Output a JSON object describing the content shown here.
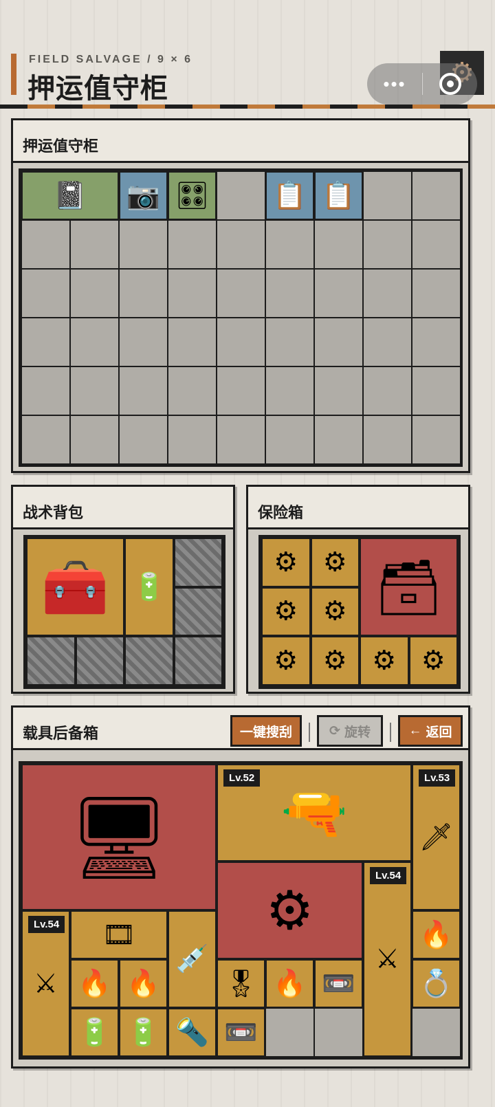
{
  "header": {
    "subtitle": "FIELD SALVAGE / 9 × 6",
    "title": "押运值守柜",
    "capsule_dots": "•••",
    "gear_icon": "gear-icon"
  },
  "colors": {
    "accent": "#b86a32",
    "cell_empty": "#b0ada7",
    "tier_green": "#86a06a",
    "tier_blue": "#6e94ad",
    "tier_gold": "#c6973e",
    "tier_red": "#b24e4a"
  },
  "main_cabinet": {
    "title": "押运值守柜",
    "grid": "9 × 6",
    "items": [
      {
        "name": "journal",
        "icon": "journal-icon",
        "tier": "green"
      },
      {
        "name": "dashcam",
        "icon": "dashcam-icon",
        "tier": "blue"
      },
      {
        "name": "circuit-board",
        "icon": "circuit-board-icon",
        "tier": "green"
      },
      {
        "name": "tablet-1",
        "icon": "tablet-icon",
        "tier": "blue"
      },
      {
        "name": "tablet-2",
        "icon": "tablet-icon",
        "tier": "blue"
      }
    ]
  },
  "backpack": {
    "title": "战术背包",
    "items": [
      {
        "name": "tool-case",
        "icon": "tool-case-icon",
        "tier": "gold"
      },
      {
        "name": "battery-pack",
        "icon": "battery-pack-icon",
        "tier": "gold"
      }
    ]
  },
  "safebox": {
    "title": "保险箱",
    "items": [
      {
        "name": "reactor-core",
        "icon": "reactor-core-icon",
        "tier": "gold",
        "count": 8
      },
      {
        "name": "ammo-crate",
        "icon": "ammo-crate-icon",
        "tier": "red"
      }
    ]
  },
  "vehicle_box": {
    "title": "载具后备箱",
    "buttons": {
      "loot_all": "一键搜刮",
      "rotate": "旋转",
      "back": "返回"
    },
    "items": [
      {
        "name": "server-unit",
        "icon": "server-icon",
        "tier": "red"
      },
      {
        "name": "machine-gun",
        "icon": "machine-gun-icon",
        "tier": "gold",
        "level": "Lv.52"
      },
      {
        "name": "combat-blade",
        "icon": "blade-icon",
        "tier": "gold",
        "level": "Lv.53"
      },
      {
        "name": "engine-motor",
        "icon": "motor-icon",
        "tier": "red"
      },
      {
        "name": "saber-1",
        "icon": "saber-icon",
        "tier": "gold",
        "level": "Lv.54"
      },
      {
        "name": "saber-2",
        "icon": "saber-icon",
        "tier": "gold",
        "level": "Lv.54"
      },
      {
        "name": "tape-roll",
        "icon": "tape-icon",
        "tier": "gold"
      },
      {
        "name": "syringe",
        "icon": "syringe-icon",
        "tier": "gold"
      },
      {
        "name": "lighter",
        "icon": "lighter-icon",
        "tier": "gold"
      },
      {
        "name": "battery-case",
        "icon": "battery-case-icon",
        "tier": "gold"
      },
      {
        "name": "medal",
        "icon": "medal-icon",
        "tier": "gold"
      },
      {
        "name": "cassette",
        "icon": "cassette-icon",
        "tier": "gold"
      },
      {
        "name": "jewelry-box",
        "icon": "jewelry-box-icon",
        "tier": "gold"
      },
      {
        "name": "torch",
        "icon": "torch-icon",
        "tier": "gold"
      }
    ]
  }
}
